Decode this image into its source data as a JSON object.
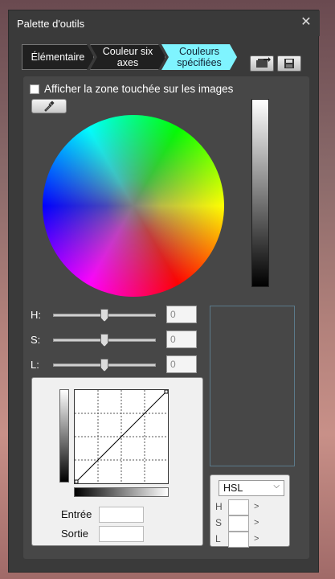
{
  "window": {
    "title": "Palette d'outils"
  },
  "tabs": [
    {
      "label": "Élémentaire"
    },
    {
      "label": "Couleur six axes"
    },
    {
      "label": "Couleurs spécifiées"
    }
  ],
  "header_icons": [
    {
      "name": "load-icon"
    },
    {
      "name": "save-icon"
    }
  ],
  "show_touched_zone": {
    "label": "Afficher la zone touchée sur les images",
    "checked": false
  },
  "sliders": [
    {
      "label": "H:",
      "value": "0",
      "level": 0.5
    },
    {
      "label": "S:",
      "value": "0",
      "level": 0.5
    },
    {
      "label": "L:",
      "value": "0",
      "level": 0.5
    }
  ],
  "curve": {
    "input_label": "Entrée",
    "output_label": "Sortie",
    "input_value": "",
    "output_value": ""
  },
  "color_mode": {
    "selected": "HSL",
    "rows": [
      {
        "label": "H",
        "value": "",
        "arrow": ">"
      },
      {
        "label": "S",
        "value": "",
        "arrow": ">"
      },
      {
        "label": "L",
        "value": "",
        "arrow": ">"
      }
    ]
  },
  "colors": {
    "active_tab": "#7ff4ff",
    "panel": "#474747",
    "titlebar": "#3a3a3a"
  }
}
